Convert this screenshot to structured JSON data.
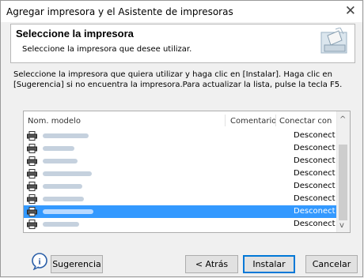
{
  "window": {
    "title": "Agregar impresora y el Asistente de impresoras",
    "close_glyph": "✕"
  },
  "header": {
    "title": "Seleccione la impresora",
    "subtitle": "Seleccione la impresora que desee utilizar."
  },
  "instructions": "Seleccione la impresora que quiera utilizar y haga clic en [Instalar]. Haga clic en [Sugerencia] si no encuentra la impresora.Para actualizar la lista, pulse la tecla F5.",
  "printer_list": {
    "columns": [
      "Nom. modelo",
      "Comentario",
      "Conectar con"
    ],
    "rows": [
      {
        "model": "",
        "comment": "",
        "connect": "Desconect"
      },
      {
        "model": "",
        "comment": "",
        "connect": "Desconect"
      },
      {
        "model": "",
        "comment": "",
        "connect": "Desconect"
      },
      {
        "model": "",
        "comment": "",
        "connect": "Desconect"
      },
      {
        "model": "",
        "comment": "",
        "connect": "Desconect"
      },
      {
        "model": "",
        "comment": "",
        "connect": "Desconect"
      },
      {
        "model": "",
        "comment": "",
        "connect": "Desconect",
        "selected": true
      },
      {
        "model": "",
        "comment": "",
        "connect": "Desconect"
      }
    ],
    "icon": "printer-icon",
    "selection_color": "#3399ff"
  },
  "buttons": {
    "hint": "Sugerencia",
    "back": "< Atrás",
    "install": "Instalar",
    "cancel": "Cancelar"
  },
  "icons": {
    "help": "info-help-icon",
    "header": "printer-wizard-icon"
  }
}
